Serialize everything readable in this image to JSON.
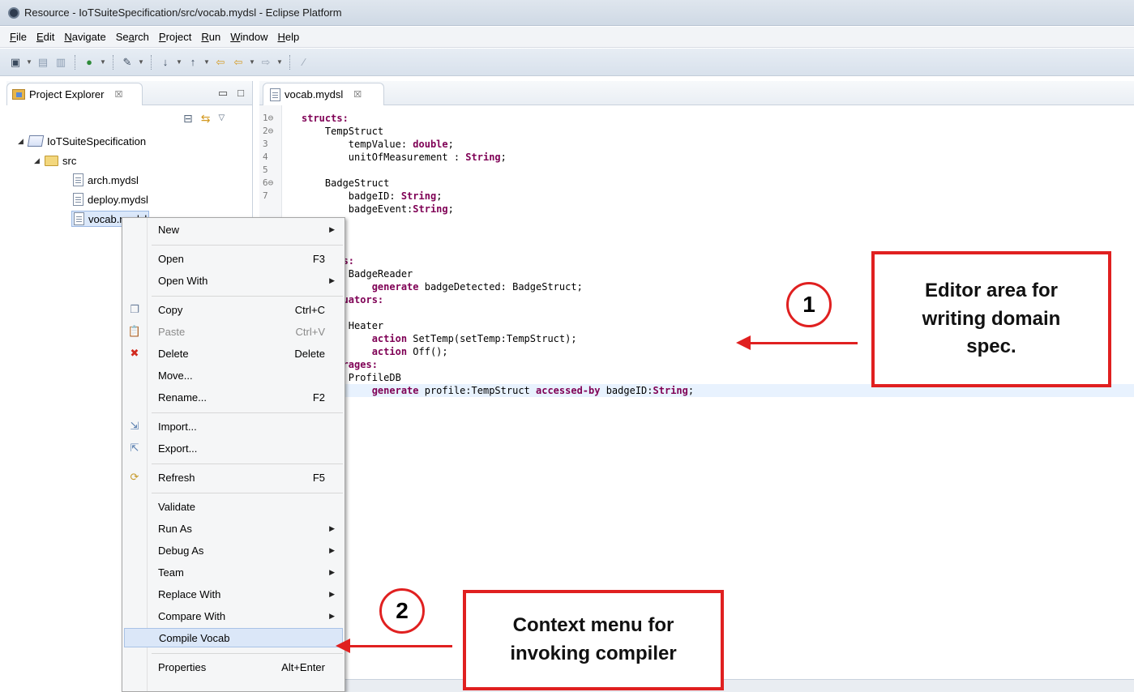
{
  "window": {
    "title": "Resource - IoTSuiteSpecification/src/vocab.mydsl - Eclipse Platform"
  },
  "menubar": [
    {
      "label": "File",
      "mnemonic": "F",
      "rest": "ile"
    },
    {
      "label": "Edit",
      "mnemonic": "E",
      "rest": "dit"
    },
    {
      "label": "Navigate",
      "mnemonic": "N",
      "rest": "avigate"
    },
    {
      "label": "Search",
      "pre": "Se",
      "mnemonic": "a",
      "rest": "rch"
    },
    {
      "label": "Project",
      "mnemonic": "P",
      "rest": "roject"
    },
    {
      "label": "Run",
      "mnemonic": "R",
      "rest": "un"
    },
    {
      "label": "Window",
      "mnemonic": "W",
      "rest": "indow"
    },
    {
      "label": "Help",
      "mnemonic": "H",
      "rest": "elp"
    }
  ],
  "explorer": {
    "tab_label": "Project Explorer",
    "close_glyph": "☒",
    "tree": {
      "project": "IoTSuiteSpecification",
      "folder": "src",
      "files": [
        "arch.mydsl",
        "deploy.mydsl",
        "vocab.mydsl"
      ],
      "selected": "vocab.mydsl"
    }
  },
  "editor": {
    "tab_label": "vocab.mydsl",
    "close_glyph": "☒",
    "lines": [
      {
        "n": "1⊖",
        "text": "structs:",
        "kw": true
      },
      {
        "n": "2⊖",
        "text": "    TempStruct"
      },
      {
        "n": "3",
        "pre": "        tempValue: ",
        "kwpart": "double",
        "post": ";"
      },
      {
        "n": "4",
        "pre": "        unitOfMeasurement : ",
        "kwpart": "String",
        "post": ";"
      },
      {
        "n": "5",
        "text": ""
      },
      {
        "n": "6⊖",
        "text": "    BadgeStruct"
      },
      {
        "n": "7",
        "pre": "        badgeID: ",
        "kwpart": "String",
        "post": ";"
      },
      {
        "n": "",
        "pre": "        badgeEvent:",
        "kwpart": "String",
        "post": ";"
      },
      {
        "n": "",
        "text": ""
      },
      {
        "n": "",
        "pre": "",
        "kwpart": "ces:",
        "post": ""
      },
      {
        "n": "",
        "text": ""
      },
      {
        "n": "",
        "pre": "    ",
        "kwpart": "tags:",
        "post": ""
      },
      {
        "n": "",
        "text": "        BadgeReader"
      },
      {
        "n": "",
        "pre": "            ",
        "kwpart": "generate",
        "post": " badgeDetected: BadgeStruct;"
      },
      {
        "n": "",
        "pre": "    ",
        "kwpart": "actuators:",
        "post": ""
      },
      {
        "n": "",
        "text": ""
      },
      {
        "n": "",
        "text": "        Heater"
      },
      {
        "n": "",
        "pre": "            ",
        "kwpart": "action",
        "post": " SetTemp(setTemp:TempStruct);"
      },
      {
        "n": "",
        "pre": "            ",
        "kwpart": "action",
        "post": " Off();"
      },
      {
        "n": "",
        "pre": "    ",
        "kwpart": "storages:",
        "post": ""
      },
      {
        "n": "",
        "text": "        ProfileDB"
      },
      {
        "n": "",
        "pre": "            ",
        "kwpart": "generate",
        "post": " profile:TempStruct ",
        "kwpart2": "accessed-by",
        "post2": " badgeID:",
        "kwpart3": "String",
        "post3": ";"
      }
    ]
  },
  "context_menu": {
    "items": [
      {
        "label": "New",
        "submenu": true
      },
      {
        "separator": true
      },
      {
        "label": "Open",
        "accel": "F3"
      },
      {
        "label": "Open With",
        "submenu": true
      },
      {
        "separator": true
      },
      {
        "label": "Copy",
        "accel": "Ctrl+C",
        "icon": "copy-icon",
        "glyph": "❐"
      },
      {
        "label": "Paste",
        "accel": "Ctrl+V",
        "icon": "paste-icon",
        "glyph": "📋",
        "disabled": true
      },
      {
        "label": "Delete",
        "accel": "Delete",
        "icon": "delete-icon",
        "glyph": "✖"
      },
      {
        "label": "Move..."
      },
      {
        "label": "Rename...",
        "accel": "F2"
      },
      {
        "separator": true
      },
      {
        "label": "Import...",
        "icon": "import-icon",
        "glyph": "⇲"
      },
      {
        "label": "Export...",
        "icon": "export-icon",
        "glyph": "⇱"
      },
      {
        "separator": true
      },
      {
        "label": "Refresh",
        "accel": "F5",
        "icon": "refresh-icon",
        "glyph": "⟳"
      },
      {
        "separator": true
      },
      {
        "label": "Validate"
      },
      {
        "label": "Run As",
        "submenu": true
      },
      {
        "label": "Debug As",
        "submenu": true
      },
      {
        "label": "Team",
        "submenu": true
      },
      {
        "label": "Replace With",
        "submenu": true
      },
      {
        "label": "Compare With",
        "submenu": true
      },
      {
        "label": "Compile Vocab",
        "highlighted": true
      },
      {
        "separator": true
      },
      {
        "label": "Properties",
        "accel": "Alt+Enter"
      }
    ]
  },
  "annotations": {
    "callout1": {
      "number": "1",
      "lines": [
        "Editor area for",
        "writing domain",
        "spec."
      ]
    },
    "callout2": {
      "number": "2",
      "lines": [
        "Context menu for",
        "invoking compiler"
      ]
    },
    "accent_color": "#e02020"
  }
}
